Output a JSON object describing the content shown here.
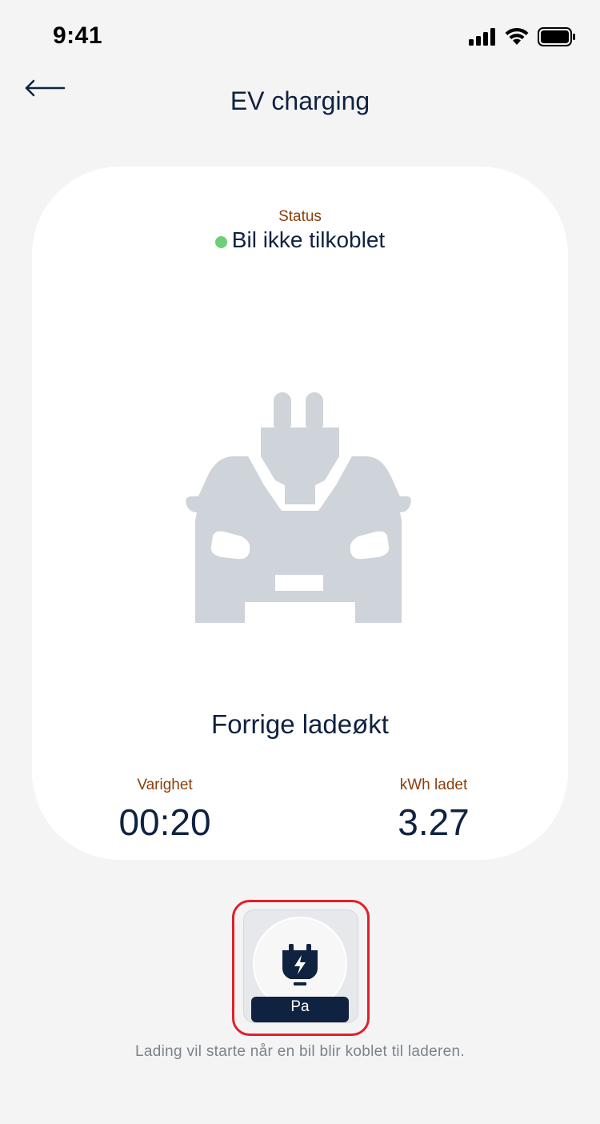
{
  "status_bar": {
    "time": "9:41"
  },
  "header": {
    "title": "EV charging"
  },
  "card": {
    "status_label": "Status",
    "status_value": "Bil ikke tilkoblet",
    "status_color": "#6dcf77",
    "last_session_title": "Forrige ladeøkt",
    "duration_label": "Varighet",
    "duration_value": "00:20",
    "energy_label": "kWh ladet",
    "energy_value": "3.27"
  },
  "toggle": {
    "label": "Pa",
    "icon": "plug-lightning-icon"
  },
  "helper_text": "Lading vil starte når en bil blir koblet til laderen.",
  "colors": {
    "primary": "#0f2240",
    "accent_label": "#8a3e0a",
    "highlight": "#e0202a",
    "status_ok": "#6dcf77"
  }
}
